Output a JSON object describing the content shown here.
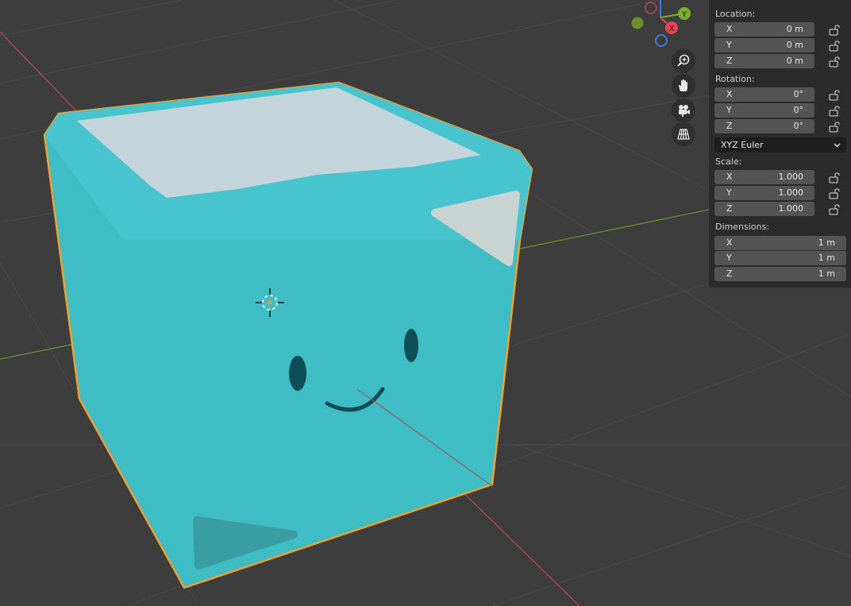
{
  "gizmo": {
    "x_label": "X",
    "y_label": "Y",
    "colors": {
      "x": "#e94358",
      "y": "#7ab02b",
      "z": "#3c7be0"
    }
  },
  "nav_tools": [
    {
      "name": "zoom-icon"
    },
    {
      "name": "pan-hand-icon"
    },
    {
      "name": "camera-view-icon"
    },
    {
      "name": "ortho-grid-icon"
    }
  ],
  "transform": {
    "location": {
      "label": "Location:",
      "x": {
        "axis": "X",
        "value": "0 m"
      },
      "y": {
        "axis": "Y",
        "value": "0 m"
      },
      "z": {
        "axis": "Z",
        "value": "0 m"
      }
    },
    "rotation": {
      "label": "Rotation:",
      "x": {
        "axis": "X",
        "value": "0°"
      },
      "y": {
        "axis": "Y",
        "value": "0°"
      },
      "z": {
        "axis": "Z",
        "value": "0°"
      },
      "mode": "XYZ Euler"
    },
    "scale": {
      "label": "Scale:",
      "x": {
        "axis": "X",
        "value": "1.000"
      },
      "y": {
        "axis": "Y",
        "value": "1.000"
      },
      "z": {
        "axis": "Z",
        "value": "1.000"
      }
    },
    "dimensions": {
      "label": "Dimensions:",
      "x": {
        "axis": "X",
        "value": "1 m"
      },
      "y": {
        "axis": "Y",
        "value": "1 m"
      },
      "z": {
        "axis": "Z",
        "value": "1 m"
      }
    }
  },
  "colors": {
    "viewport_bg": "#3d3d3d",
    "panel_bg": "#2b2b2b",
    "field_bg": "#545454",
    "selection_outline": "#f0a030",
    "cube_body": "#42bcc3",
    "x_axis_line": "#b04a55",
    "y_axis_line": "#6e8f2a"
  }
}
